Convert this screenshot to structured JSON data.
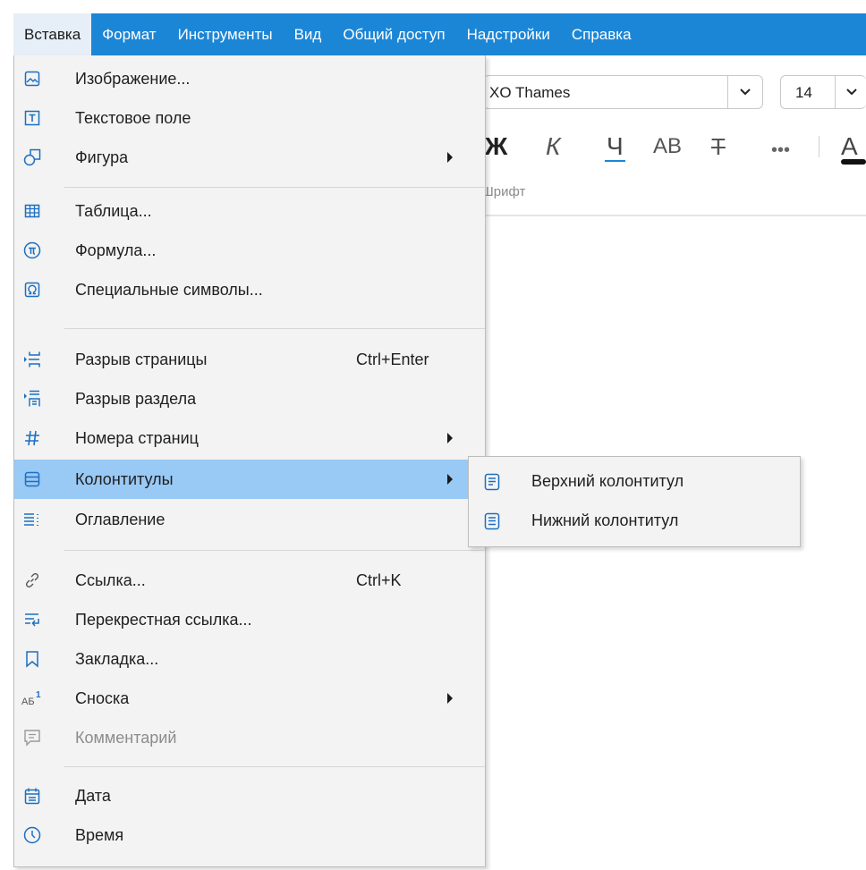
{
  "menubar": {
    "items": [
      {
        "label": "Вставка"
      },
      {
        "label": "Формат"
      },
      {
        "label": "Инструменты"
      },
      {
        "label": "Вид"
      },
      {
        "label": "Общий доступ"
      },
      {
        "label": "Надстройки"
      },
      {
        "label": "Справка"
      }
    ]
  },
  "toolbar": {
    "font_name": "XO Thames",
    "font_size": "14",
    "bold": "Ж",
    "italic": "К",
    "underline": "Ч",
    "caps": "АВ",
    "strike": "Т",
    "more": "•••",
    "font_color": "А",
    "group_label": "Шрифт"
  },
  "menu": {
    "items": [
      {
        "label": "Изображение...",
        "icon": "image-icon"
      },
      {
        "label": "Текстовое поле",
        "icon": "text-box-icon"
      },
      {
        "label": "Фигура",
        "icon": "shape-icon",
        "submenu": true
      },
      {
        "label": "Таблица...",
        "icon": "table-icon"
      },
      {
        "label": "Формула...",
        "icon": "pi-formula-icon"
      },
      {
        "label": "Специальные символы...",
        "icon": "omega-icon"
      },
      {
        "label": "Разрыв страницы",
        "shortcut": "Ctrl+Enter",
        "icon": "page-break-icon"
      },
      {
        "label": "Разрыв раздела",
        "icon": "section-break-icon"
      },
      {
        "label": "Номера страниц",
        "icon": "hash-icon",
        "submenu": true
      },
      {
        "label": "Колонтитулы",
        "icon": "header-footer-icon",
        "submenu": true,
        "highlighted": true
      },
      {
        "label": "Оглавление",
        "icon": "toc-icon"
      },
      {
        "label": "Ссылка...",
        "shortcut": "Ctrl+K",
        "icon": "link-icon"
      },
      {
        "label": "Перекрестная ссылка...",
        "icon": "cross-reference-icon"
      },
      {
        "label": "Закладка...",
        "icon": "bookmark-icon"
      },
      {
        "label": "Сноска",
        "icon": "footnote-icon",
        "submenu": true
      },
      {
        "label": "Комментарий",
        "icon": "comment-icon",
        "disabled": true
      },
      {
        "label": "Дата",
        "icon": "calendar-icon"
      },
      {
        "label": "Время",
        "icon": "clock-icon"
      }
    ]
  },
  "submenu": {
    "items": [
      {
        "label": "Верхний колонтитул",
        "icon": "header-icon"
      },
      {
        "label": "Нижний колонтитул",
        "icon": "footer-icon"
      }
    ]
  },
  "colors": {
    "menubar_bg": "#1c86d6",
    "highlight_bg": "#99c9f5",
    "icon_color": "#1c6fc0"
  }
}
